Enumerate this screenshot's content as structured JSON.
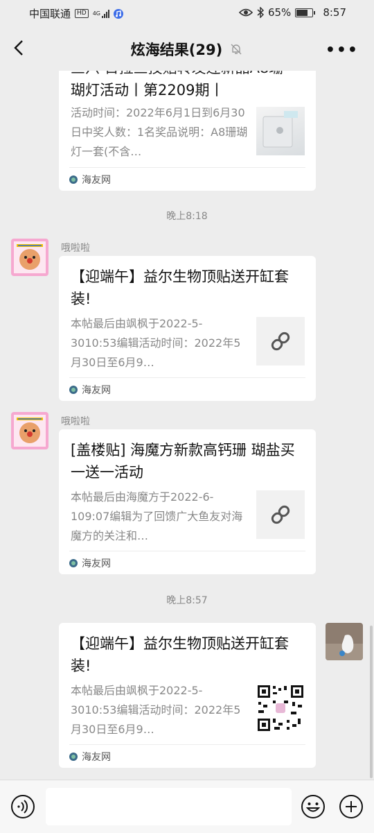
{
  "status": {
    "carrier": "中国联通",
    "hd": "HD",
    "network": "4G",
    "battery_percent": "65%",
    "battery_level": 0.65,
    "time": "8:57"
  },
  "header": {
    "title": "炫海结果(29)"
  },
  "messages": [
    {
      "title_tail": "瑚灯活动丨第2209期丨",
      "desc": "活动时间：2022年6月1日到6月30日中奖人数：1名奖品说明：A8珊瑚灯一套(不含…",
      "source": "海友网"
    },
    {
      "time": "晚上8:18",
      "nick": "哦啦啦",
      "title": "【迎端午】益尔生物顶贴送开缸套装!",
      "desc": "本帖最后由飒枫于2022-5-3010:53编辑活动时间：2022年5月30日至6月9…",
      "source": "海友网"
    },
    {
      "nick": "哦啦啦",
      "title": "[盖楼贴] 海魔方新款高钙珊 瑚盐买一送一活动",
      "desc": "本帖最后由海魔方于2022-6-109:07编辑为了回馈广大鱼友对海魔方的关注和…",
      "source": "海友网"
    },
    {
      "time": "晚上8:57",
      "title": "【迎端午】益尔生物顶贴送开缸套装!",
      "desc": "本帖最后由飒枫于2022-5-3010:53编辑活动时间：2022年5月30日至6月9…",
      "source": "海友网"
    }
  ],
  "input": {
    "placeholder": ""
  }
}
